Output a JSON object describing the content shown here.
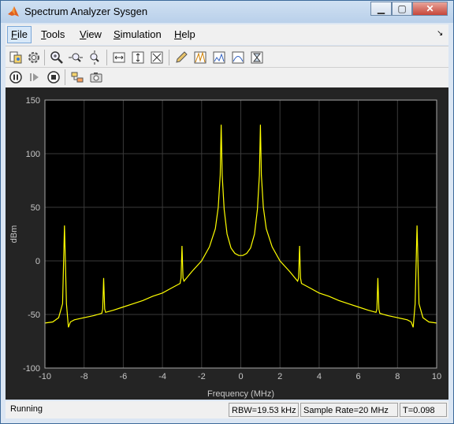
{
  "window": {
    "title": "Spectrum Analyzer Sysgen"
  },
  "menu": {
    "items": [
      "File",
      "Tools",
      "View",
      "Simulation",
      "Help"
    ],
    "underline": [
      "F",
      "T",
      "V",
      "S",
      "H"
    ]
  },
  "toolbar1": {
    "icons": [
      "library-icon",
      "settings-gear-icon",
      "zoom-in-icon",
      "zoom-x-icon",
      "zoom-y-icon",
      "fit-x-icon",
      "fit-y-icon",
      "fit-to-view-icon",
      "edit-icon",
      "peak-finder-icon",
      "spectrum-measure-icon",
      "distortion-icon",
      "ccdf-icon"
    ]
  },
  "toolbar2": {
    "icons": [
      "pause-icon",
      "step-forward-icon",
      "stop-icon",
      "highlight-block-icon",
      "snapshot-camera-icon"
    ]
  },
  "chart_data": {
    "type": "line",
    "xlabel": "Frequency (MHz)",
    "ylabel": "dBm",
    "xlim": [
      -10,
      10
    ],
    "ylim": [
      -100,
      150
    ],
    "xticks": [
      "-10",
      "-8",
      "-6",
      "-4",
      "-2",
      "0",
      "2",
      "4",
      "6",
      "8",
      "10"
    ],
    "yticks": [
      "150",
      "100",
      "50",
      "0",
      "-50",
      "-100"
    ],
    "grid": true,
    "background": "#000000",
    "series": [
      {
        "color": "#ffff00",
        "x": [
          -10,
          -9.6,
          -9.3,
          -9.1,
          -9.0,
          -8.9,
          -8.8,
          -8.7,
          -8.5,
          -8.0,
          -7.5,
          -7.1,
          -7.05,
          -7.0,
          -6.95,
          -6.9,
          -6.5,
          -6.0,
          -5.5,
          -5.0,
          -4.5,
          -4.0,
          -3.5,
          -3.1,
          -3.05,
          -3.0,
          -2.95,
          -2.9,
          -2.5,
          -2.0,
          -1.6,
          -1.3,
          -1.15,
          -1.05,
          -1.0,
          -0.95,
          -0.85,
          -0.7,
          -0.5,
          -0.3,
          -0.1,
          0.0,
          0.1,
          0.3,
          0.5,
          0.7,
          0.85,
          0.95,
          1.0,
          1.05,
          1.15,
          1.3,
          1.6,
          2.0,
          2.5,
          2.9,
          2.95,
          3.0,
          3.05,
          3.1,
          3.5,
          4.0,
          4.5,
          5.0,
          5.5,
          6.0,
          6.5,
          6.9,
          6.95,
          7.0,
          7.05,
          7.1,
          7.5,
          8.0,
          8.5,
          8.7,
          8.8,
          8.9,
          9.0,
          9.1,
          9.3,
          9.6,
          10
        ],
        "y": [
          -58,
          -57,
          -53,
          -40,
          33,
          -40,
          -62,
          -57,
          -55,
          -53,
          -51,
          -49,
          -45,
          -16,
          -45,
          -48,
          -46,
          -43,
          -40,
          -37,
          -33,
          -30,
          -25,
          -21,
          -16,
          14,
          -16,
          -19,
          -10,
          0,
          13,
          30,
          50,
          80,
          127,
          80,
          48,
          25,
          12,
          7,
          5,
          5,
          5,
          7,
          12,
          25,
          48,
          80,
          127,
          80,
          50,
          30,
          13,
          0,
          -10,
          -19,
          -16,
          14,
          -16,
          -21,
          -25,
          -30,
          -33,
          -37,
          -40,
          -43,
          -46,
          -48,
          -45,
          -16,
          -45,
          -49,
          -51,
          -53,
          -55,
          -57,
          -62,
          -40,
          33,
          -40,
          -53,
          -57,
          -58
        ]
      }
    ]
  },
  "status": {
    "state": "Running",
    "rbw": "RBW=19.53 kHz",
    "sample_rate": "Sample Rate=20 MHz",
    "time": "T=0.098"
  }
}
